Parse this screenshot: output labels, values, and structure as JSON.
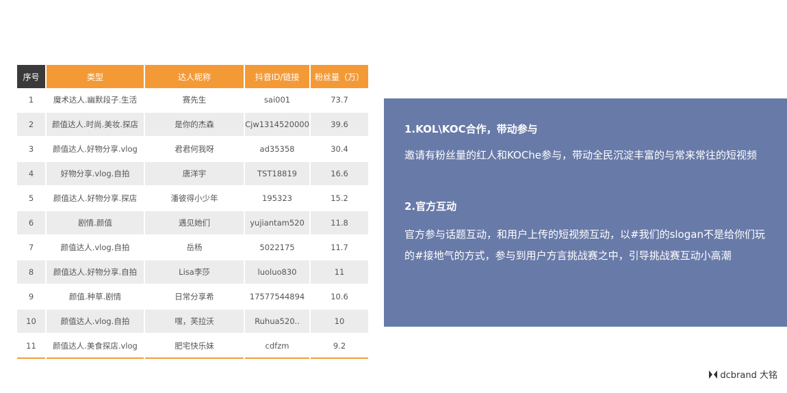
{
  "table": {
    "headers": [
      "序号",
      "类型",
      "达人昵称",
      "抖音ID/链接",
      "粉丝量（万）"
    ],
    "rows": [
      [
        "1",
        "魔术达人.幽默段子.生活",
        "赛先生",
        "sai001",
        "73.7"
      ],
      [
        "2",
        "颜值达人.时尚.美妆.探店",
        "是你的杰森",
        "Cjw1314520000",
        "39.6"
      ],
      [
        "3",
        "颜值达人.好物分享.vlog",
        "君君何我呀",
        "ad35358",
        "30.4"
      ],
      [
        "4",
        "好物分享.vlog.自拍",
        "唐洋宇",
        "TST18819",
        "16.6"
      ],
      [
        "5",
        "颜值达人.好物分享.探店",
        "潘彼得小少年",
        "195323",
        "15.2"
      ],
      [
        "6",
        "剧情.颜值",
        "遇见她们",
        "yujiantam520",
        "11.8"
      ],
      [
        "7",
        "颜值达人.vlog.自拍",
        "岳杨",
        "5022175",
        "11.7"
      ],
      [
        "8",
        "颜值达人.好物分享.自拍",
        "Lisa李莎",
        "luoluo830",
        "11"
      ],
      [
        "9",
        "颜值.种草.剧情",
        "日常分享希",
        "17577544894",
        "10.6"
      ],
      [
        "10",
        "颜值达人.vlog.自拍",
        "嘿，芙拉沃",
        "Ruhua520..",
        "10"
      ],
      [
        "11",
        "颜值达人.美食探店.vlog",
        "肥宅快乐妹",
        "cdfzm",
        "9.2"
      ]
    ]
  },
  "info": {
    "section1_title": "1.KOL\\KOC合作，带动参与",
    "section1_text": "邀请有粉丝量的红人和KOChe参与，带动全民沉淀丰富的与常来常往的短视频",
    "section2_title": "2.官方互动",
    "section2_text": "官方参与话题互动，和用户上传的短视频互动，以#我们的slogan不是给你们玩的#接地气的方式，参与到用户方言挑战赛之中，引导挑战赛互动小高潮"
  },
  "logo": {
    "text": "dcbrand 大铭"
  },
  "colors": {
    "accent": "#f39a37",
    "dark_header": "#3a3a3a",
    "info_box": "#687aa8"
  }
}
